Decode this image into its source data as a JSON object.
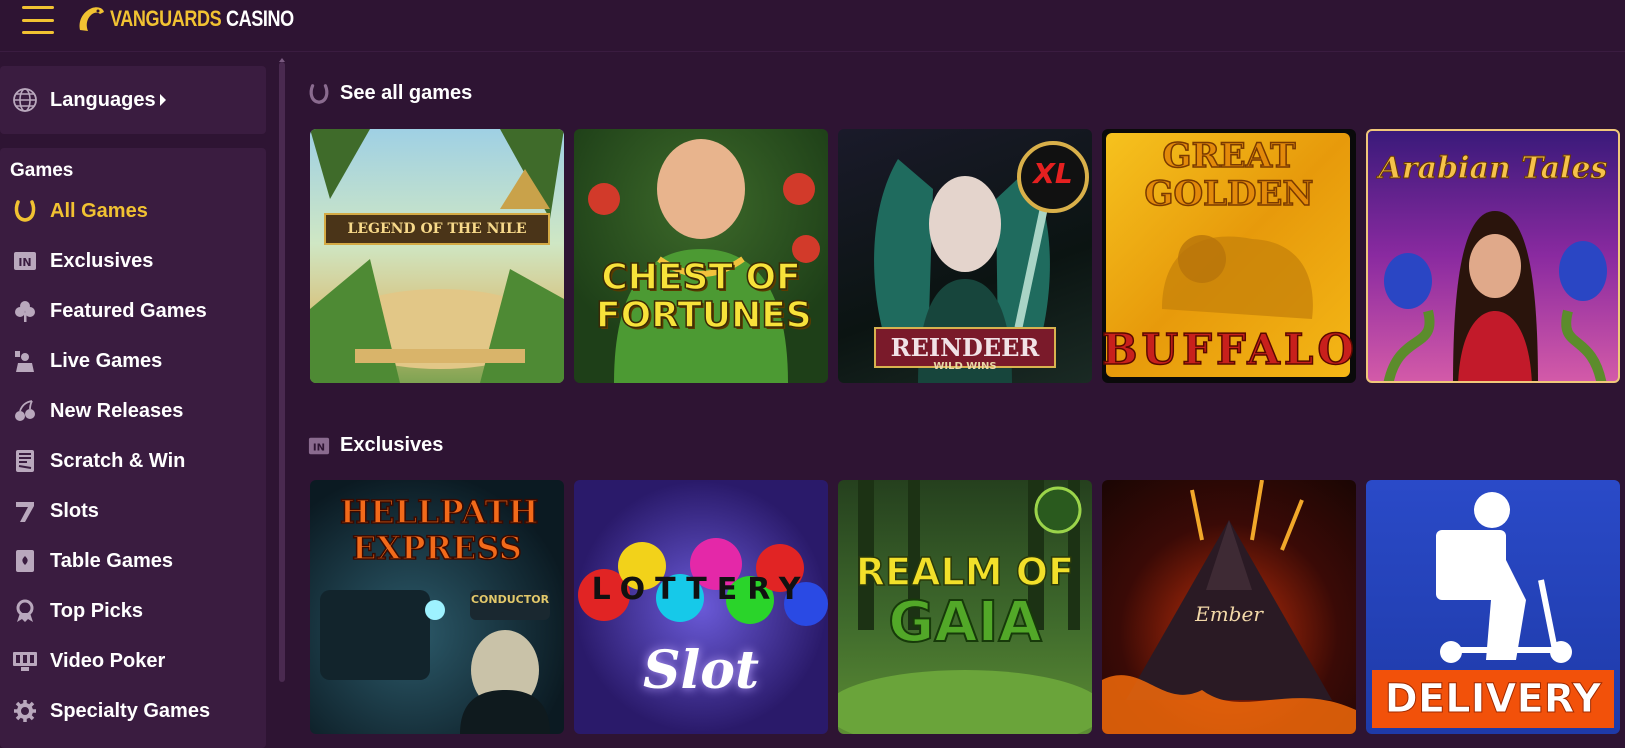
{
  "brand": {
    "part1": "VANGUARDS",
    "part2": "CASINO",
    "accent": "#f1c232"
  },
  "sidebar": {
    "languages_label": "Languages",
    "games_heading": "Games",
    "items": [
      {
        "label": "All Games",
        "icon": "horseshoe-icon",
        "active": true
      },
      {
        "label": "Exclusives",
        "icon": "in-badge-icon"
      },
      {
        "label": "Featured Games",
        "icon": "clover-icon"
      },
      {
        "label": "Live Games",
        "icon": "dealer-icon"
      },
      {
        "label": "New Releases",
        "icon": "cherry-icon"
      },
      {
        "label": "Scratch & Win",
        "icon": "scratch-ticket-icon"
      },
      {
        "label": "Slots",
        "icon": "seven-icon"
      },
      {
        "label": "Table Games",
        "icon": "playing-card-icon"
      },
      {
        "label": "Top Picks",
        "icon": "award-ribbon-icon"
      },
      {
        "label": "Video Poker",
        "icon": "video-poker-icon"
      },
      {
        "label": "Specialty Games",
        "icon": "gear-icon"
      }
    ]
  },
  "sections": {
    "all": {
      "title": "See all games",
      "games": [
        {
          "name": "Legend of the Nile",
          "display": "LEGEND OF THE NILE"
        },
        {
          "name": "Chest of Fortunes",
          "display": "CHEST OF FORTUNES"
        },
        {
          "name": "Reindeer Wild Wins",
          "display": "REINDEER",
          "sub": "WILD WINS",
          "badge": "XL"
        },
        {
          "name": "Great Golden Buffalo",
          "display": "GREAT GOLDEN",
          "sub": "BUFFALO"
        },
        {
          "name": "Arabian Tales",
          "display": "Arabian Tales"
        }
      ]
    },
    "exclusives": {
      "title": "Exclusives",
      "games": [
        {
          "name": "Hellpath Express",
          "display": "HELLPATH EXPRESS",
          "sub": "CONDUCTOR"
        },
        {
          "name": "Lottery Slot",
          "display": "LOTTERY",
          "sub": "Slot"
        },
        {
          "name": "Realm of Gaia",
          "display": "REALM OF",
          "sub": "GAIA"
        },
        {
          "name": "Ember",
          "display": "Ember"
        },
        {
          "name": "Delivery",
          "display": "DELIVERY"
        }
      ]
    }
  }
}
